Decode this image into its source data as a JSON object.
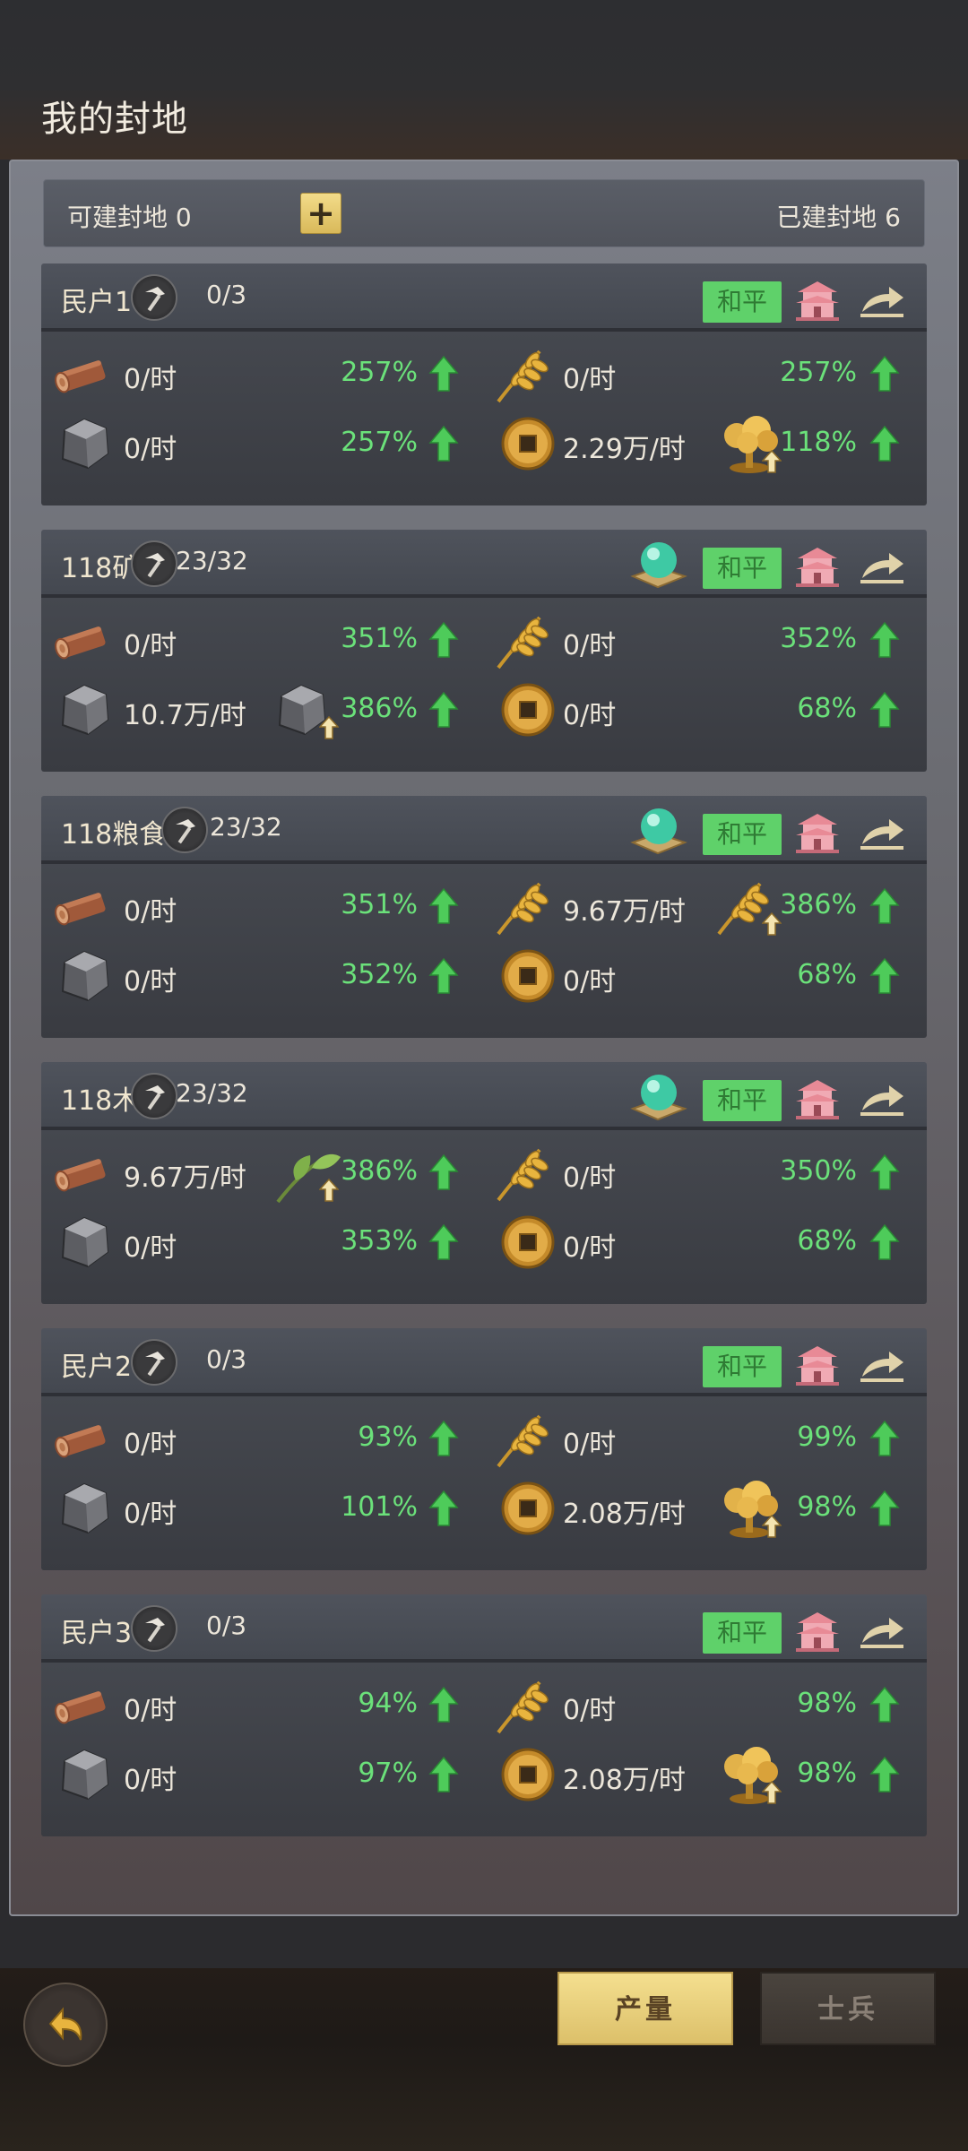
{
  "header": {
    "title": "我的封地"
  },
  "summary": {
    "available": "可建封地 0",
    "plus": "+",
    "built": "已建封地 6"
  },
  "peace_label": "和平",
  "fiefs": [
    {
      "name": "民户1",
      "count": "0/3",
      "has_orb": false,
      "wood": "0/时",
      "wood_pct": "257%",
      "grain": "0/时",
      "grain_pct": "257%",
      "stone": "0/时",
      "stone_pct": "257%",
      "coin": "2.29万/时",
      "coin_pct": "118%",
      "boost": "coin"
    },
    {
      "name": "118矿",
      "count": "23/32",
      "has_orb": true,
      "wood": "0/时",
      "wood_pct": "351%",
      "grain": "0/时",
      "grain_pct": "352%",
      "stone": "10.7万/时",
      "stone_pct": "386%",
      "coin": "0/时",
      "coin_pct": "68%",
      "boost": "stone"
    },
    {
      "name": "118粮食",
      "count": "23/32",
      "has_orb": true,
      "wood": "0/时",
      "wood_pct": "351%",
      "grain": "9.67万/时",
      "grain_pct": "386%",
      "stone": "0/时",
      "stone_pct": "352%",
      "coin": "0/时",
      "coin_pct": "68%",
      "boost": "grain"
    },
    {
      "name": "118木",
      "count": "23/32",
      "has_orb": true,
      "wood": "9.67万/时",
      "wood_pct": "386%",
      "grain": "0/时",
      "grain_pct": "350%",
      "stone": "0/时",
      "stone_pct": "353%",
      "coin": "0/时",
      "coin_pct": "68%",
      "boost": "wood"
    },
    {
      "name": "民户2",
      "count": "0/3",
      "has_orb": false,
      "wood": "0/时",
      "wood_pct": "93%",
      "grain": "0/时",
      "grain_pct": "99%",
      "stone": "0/时",
      "stone_pct": "101%",
      "coin": "2.08万/时",
      "coin_pct": "98%",
      "boost": "coin"
    },
    {
      "name": "民户3",
      "count": "0/3",
      "has_orb": false,
      "wood": "0/时",
      "wood_pct": "94%",
      "grain": "0/时",
      "grain_pct": "98%",
      "stone": "0/时",
      "stone_pct": "97%",
      "coin": "2.08万/时",
      "coin_pct": "98%",
      "boost": "coin"
    }
  ],
  "tabs": {
    "production": "产量",
    "soldiers": "士兵"
  },
  "colors": {
    "accent_gold": "#dcc06a",
    "peace_green": "#5fd16a",
    "percent_green": "#6be17a"
  }
}
